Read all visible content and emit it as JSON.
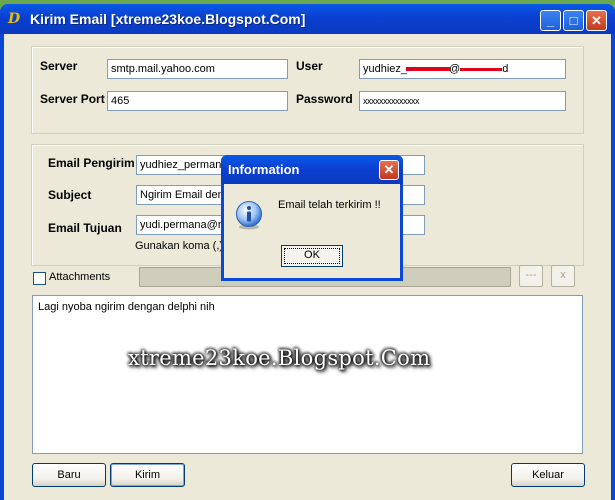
{
  "window": {
    "title": "Kirim Email [xtreme23koe.Blogspot.Com]",
    "controls": {
      "minimize": "_",
      "maximize": "□",
      "close": "✕"
    }
  },
  "server_group": {
    "server_label": "Server",
    "server_value": "smtp.mail.yahoo.com",
    "port_label": "Server Port",
    "port_value": "465",
    "user_label": "User",
    "user_value_start": "yudhiez_",
    "user_value_mid": "@",
    "user_value_end": "d",
    "password_label": "Password",
    "password_value": "xxxxxxxxxxxxxx"
  },
  "email_group": {
    "sender_label": "Email Pengirim",
    "sender_value": "yudhiez_permana",
    "subject_label": "Subject",
    "subject_value": "Ngirim Email deng",
    "recipient_label": "Email Tujuan",
    "recipient_value": "yudi.permana@m",
    "hint": "Gunakan koma (,)"
  },
  "attachments": {
    "label": "Attachments",
    "browse_label": "---",
    "remove_label": "x"
  },
  "message_body": "Lagi nyoba ngirim dengan delphi nih",
  "watermark": "xtreme23koe.Blogspot.Com",
  "buttons": {
    "new": "Baru",
    "send": "Kirim",
    "exit": "Keluar"
  },
  "dialog": {
    "title": "Information",
    "message": "Email telah terkirim !!",
    "ok": "OK",
    "close": "✕"
  },
  "colors": {
    "titlebar": "#0a47d6",
    "redaction": "#e0001b",
    "client": "#ece9d8"
  }
}
